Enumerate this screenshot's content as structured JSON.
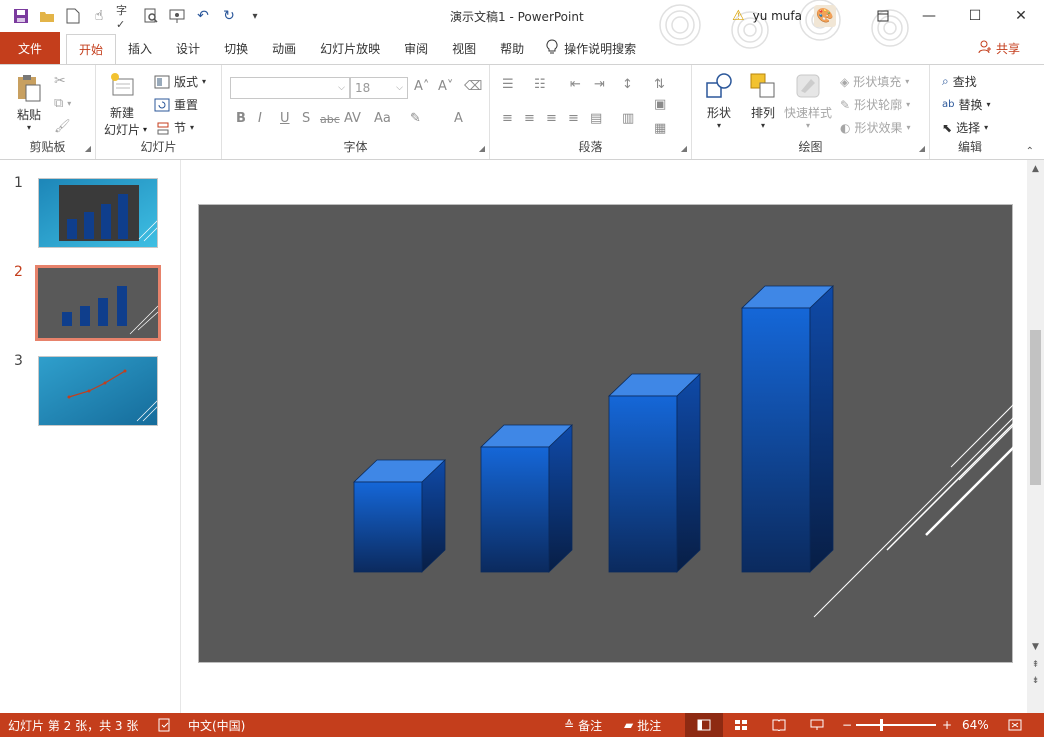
{
  "app": {
    "doc_title": "演示文稿1  -  PowerPoint",
    "user_name": "yu mufa"
  },
  "tabs": [
    {
      "label": "文件"
    },
    {
      "label": "开始"
    },
    {
      "label": "插入"
    },
    {
      "label": "设计"
    },
    {
      "label": "切换"
    },
    {
      "label": "动画"
    },
    {
      "label": "幻灯片放映"
    },
    {
      "label": "审阅"
    },
    {
      "label": "视图"
    },
    {
      "label": "帮助"
    }
  ],
  "tell_me": "操作说明搜索",
  "share": "共享",
  "ribbon": {
    "clipboard": {
      "label": "剪贴板",
      "paste": "粘贴"
    },
    "slides": {
      "label": "幻灯片",
      "new_slide_1": "新建",
      "new_slide_2": "幻灯片",
      "layout": "版式",
      "reset": "重置",
      "section": "节"
    },
    "font": {
      "label": "字体",
      "font_size": "18"
    },
    "paragraph": {
      "label": "段落"
    },
    "drawing": {
      "label": "绘图",
      "shapes": "形状",
      "arrange": "排列",
      "quick_styles": "快速样式",
      "fill": "形状填充",
      "outline": "形状轮廓",
      "effects": "形状效果"
    },
    "editing": {
      "label": "编辑",
      "find": "查找",
      "replace": "替换",
      "select": "选择"
    }
  },
  "thumbnails": [
    {
      "number": "1"
    },
    {
      "number": "2"
    },
    {
      "number": "3"
    }
  ],
  "status": {
    "slide_info": "幻灯片 第 2 张，共 3 张",
    "language": "中文(中国)",
    "notes": "备注",
    "comments": "批注",
    "zoom": "64%"
  },
  "colors": {
    "accent": "#c43e1c",
    "slide_bg": "#595959",
    "bar_front_top": "#1565d6",
    "bar_front_bottom": "#0a2a5c"
  }
}
